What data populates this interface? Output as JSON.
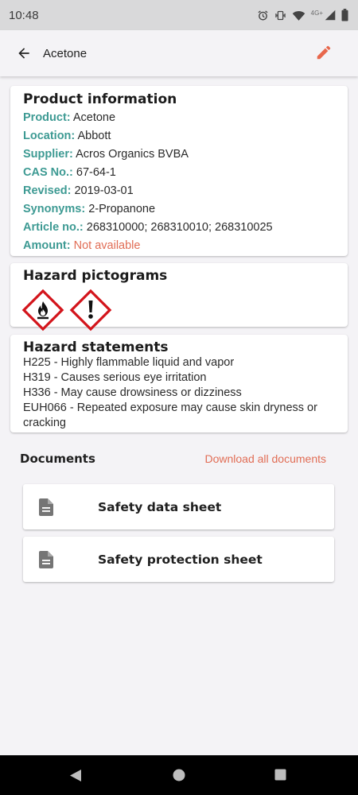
{
  "status_bar": {
    "time": "10:48",
    "network": "4G+",
    "icons": [
      "alarm-icon",
      "vibrate-icon",
      "wifi-icon",
      "cell-signal-icon",
      "battery-icon"
    ]
  },
  "app_bar": {
    "title": "Acetone",
    "back_icon": "arrow-back-icon",
    "edit_icon": "pencil-icon"
  },
  "product_info": {
    "title": "Product information",
    "fields": [
      {
        "key": "Product:",
        "value": "Acetone"
      },
      {
        "key": "Location:",
        "value": "Abbott"
      },
      {
        "key": "Supplier:",
        "value": "Acros Organics BVBA"
      },
      {
        "key": "CAS No.:",
        "value": "67-64-1"
      },
      {
        "key": "Revised:",
        "value": "2019-03-01"
      },
      {
        "key": "Synonyms:",
        "value": "2-Propanone"
      },
      {
        "key": "Article no.:",
        "value": "268310000; 268310010; 268310025"
      },
      {
        "key": "Amount:",
        "value": "Not available"
      }
    ]
  },
  "hazard_pictograms": {
    "title": "Hazard pictograms",
    "icons": [
      "flammable-pictogram-icon",
      "exclamation-pictogram-icon"
    ]
  },
  "hazard_statements": {
    "title": "Hazard statements",
    "lines": [
      "H225 - Highly flammable liquid and vapor",
      "H319 - Causes serious eye irritation",
      "H336 - May cause drowsiness or dizziness",
      "EUH066 - Repeated exposure may cause skin dryness or",
      "cracking"
    ]
  },
  "documents": {
    "title": "Documents",
    "download_all": "Download all documents",
    "items": [
      {
        "label": "Safety data sheet",
        "icon": "document-icon"
      },
      {
        "label": "Safety protection sheet",
        "icon": "document-icon"
      }
    ]
  },
  "colors": {
    "accent_teal": "#3d9a93",
    "accent_orange": "#e16d55",
    "hazard_red": "#d3141b"
  }
}
